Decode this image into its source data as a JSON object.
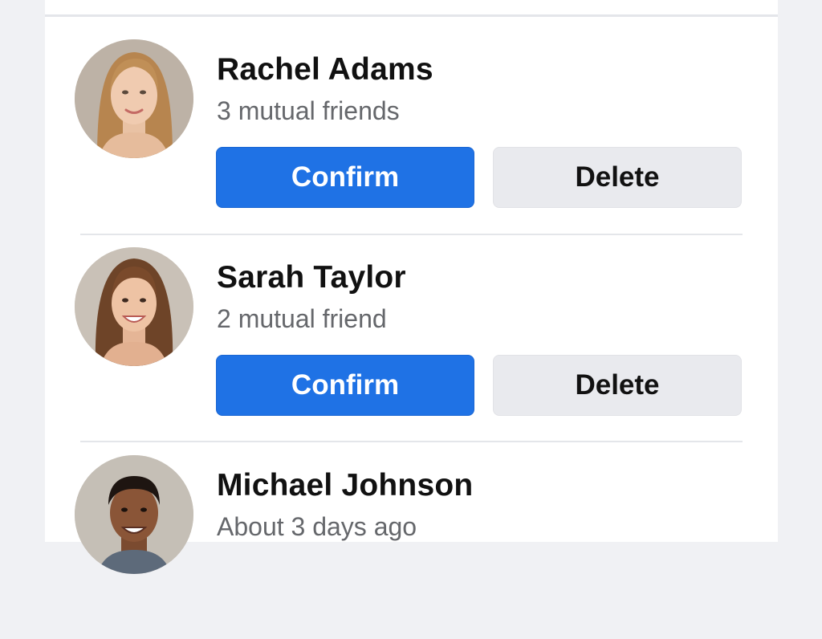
{
  "requests": [
    {
      "name": "Rachel Adams",
      "subtitle": "3 mutual friends",
      "confirm_label": "Confirm",
      "delete_label": "Delete"
    },
    {
      "name": "Sarah Taylor",
      "subtitle": "2 mutual friend",
      "confirm_label": "Confirm",
      "delete_label": "Delete"
    },
    {
      "name": "Michael Johnson",
      "subtitle": "About 3 days ago"
    }
  ],
  "colors": {
    "confirm_button": "#1f72e5",
    "delete_button": "#e9eaee",
    "page_background": "#f0f1f4"
  }
}
